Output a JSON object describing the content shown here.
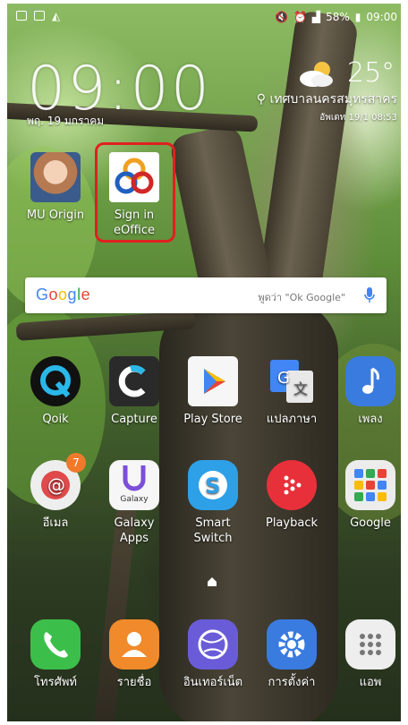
{
  "status_bar": {
    "battery": "58%",
    "time": "09:00",
    "left_icons": [
      "mail-icon",
      "gallery-icon",
      "image-icon"
    ],
    "right_icons": [
      "mute-icon",
      "alarm-icon",
      "signal-icon",
      "battery-icon"
    ]
  },
  "clock_widget": {
    "time": "09:00",
    "date": "พฤ. 19 มกราคม",
    "temperature": "25°",
    "location": "เทศบาลนครสมุทรสาคร",
    "updated": "อัพเดท 19/1 08:53"
  },
  "google_bar": {
    "logo": "Google",
    "placeholder": "พูดว่า \"Ok Google\"",
    "colors": {
      "blue": "#4285F4",
      "red": "#EA4335",
      "yellow": "#FBBC05",
      "green": "#34A853"
    }
  },
  "apps_top": [
    {
      "name": "MU Origin",
      "icon": "mu-origin-icon"
    },
    {
      "name": "Sign in eOffice",
      "label_lines": [
        "Sign in",
        "eOffice"
      ],
      "icon": "sign-in-eoffice-icon"
    }
  ],
  "apps_row1": [
    {
      "name": "Qoik",
      "icon": "qoik-icon"
    },
    {
      "name": "Capture",
      "icon": "capture-icon"
    },
    {
      "name": "Play Store",
      "icon": "play-store-icon"
    },
    {
      "name": "แปลภาษา",
      "icon": "translate-icon"
    },
    {
      "name": "เพลง",
      "icon": "music-icon"
    }
  ],
  "apps_row2": [
    {
      "name": "อีเมล",
      "icon": "email-icon",
      "badge": "7"
    },
    {
      "name": "Galaxy Apps",
      "label_lines": [
        "Galaxy",
        "Apps"
      ],
      "icon": "galaxy-apps-icon",
      "icon_text": "Galaxy"
    },
    {
      "name": "Smart Switch",
      "label_lines": [
        "Smart",
        "Switch"
      ],
      "icon": "smart-switch-icon"
    },
    {
      "name": "Playback",
      "icon": "playback-icon"
    },
    {
      "name": "Google",
      "icon": "google-folder-icon"
    }
  ],
  "dock": [
    {
      "name": "โทรศัพท์",
      "icon": "phone-icon"
    },
    {
      "name": "รายชื่อ",
      "icon": "contacts-icon"
    },
    {
      "name": "อินเทอร์เน็ต",
      "icon": "internet-icon"
    },
    {
      "name": "การตั้งค่า",
      "icon": "settings-icon"
    },
    {
      "name": "แอพ",
      "icon": "apps-drawer-icon"
    }
  ]
}
